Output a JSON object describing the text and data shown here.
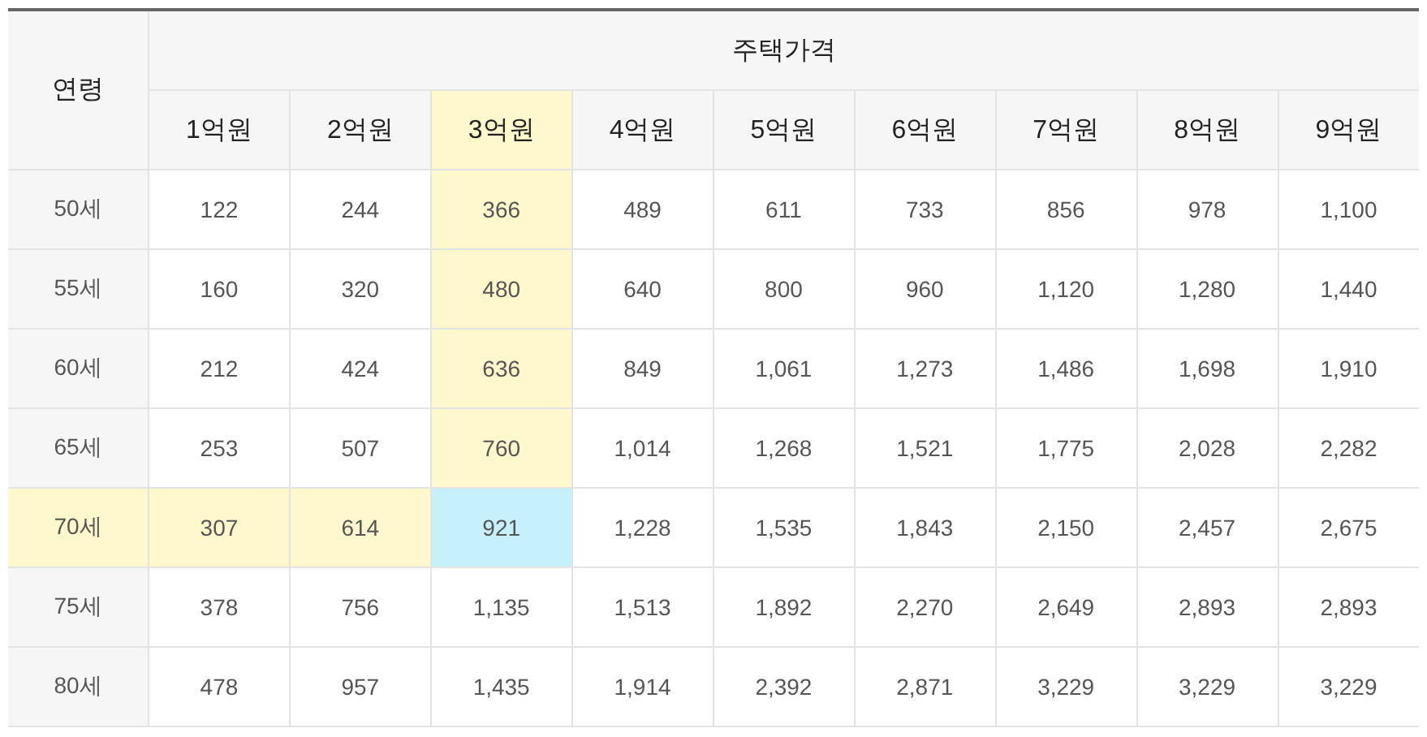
{
  "table": {
    "row_header": "연령",
    "group_header": "주택가격",
    "columns": [
      {
        "label": "1억원",
        "selected": false
      },
      {
        "label": "2억원",
        "selected": false
      },
      {
        "label": "3억원",
        "selected": true
      },
      {
        "label": "4억원",
        "selected": false
      },
      {
        "label": "5억원",
        "selected": false
      },
      {
        "label": "6억원",
        "selected": false
      },
      {
        "label": "7억원",
        "selected": false
      },
      {
        "label": "8억원",
        "selected": false
      },
      {
        "label": "9억원",
        "selected": false
      }
    ],
    "rows": [
      {
        "age": "50세",
        "selected": false,
        "values": [
          "122",
          "244",
          "366",
          "489",
          "611",
          "733",
          "856",
          "978",
          "1,100"
        ]
      },
      {
        "age": "55세",
        "selected": false,
        "values": [
          "160",
          "320",
          "480",
          "640",
          "800",
          "960",
          "1,120",
          "1,280",
          "1,440"
        ]
      },
      {
        "age": "60세",
        "selected": false,
        "values": [
          "212",
          "424",
          "636",
          "849",
          "1,061",
          "1,273",
          "1,486",
          "1,698",
          "1,910"
        ]
      },
      {
        "age": "65세",
        "selected": false,
        "values": [
          "253",
          "507",
          "760",
          "1,014",
          "1,268",
          "1,521",
          "1,775",
          "2,028",
          "2,282"
        ]
      },
      {
        "age": "70세",
        "selected": true,
        "values": [
          "307",
          "614",
          "921",
          "1,228",
          "1,535",
          "1,843",
          "2,150",
          "2,457",
          "2,675"
        ]
      },
      {
        "age": "75세",
        "selected": false,
        "values": [
          "378",
          "756",
          "1,135",
          "1,513",
          "1,892",
          "2,270",
          "2,649",
          "2,893",
          "2,893"
        ]
      },
      {
        "age": "80세",
        "selected": false,
        "values": [
          "478",
          "957",
          "1,435",
          "1,914",
          "2,392",
          "2,871",
          "3,229",
          "3,229",
          "3,229"
        ]
      }
    ]
  }
}
